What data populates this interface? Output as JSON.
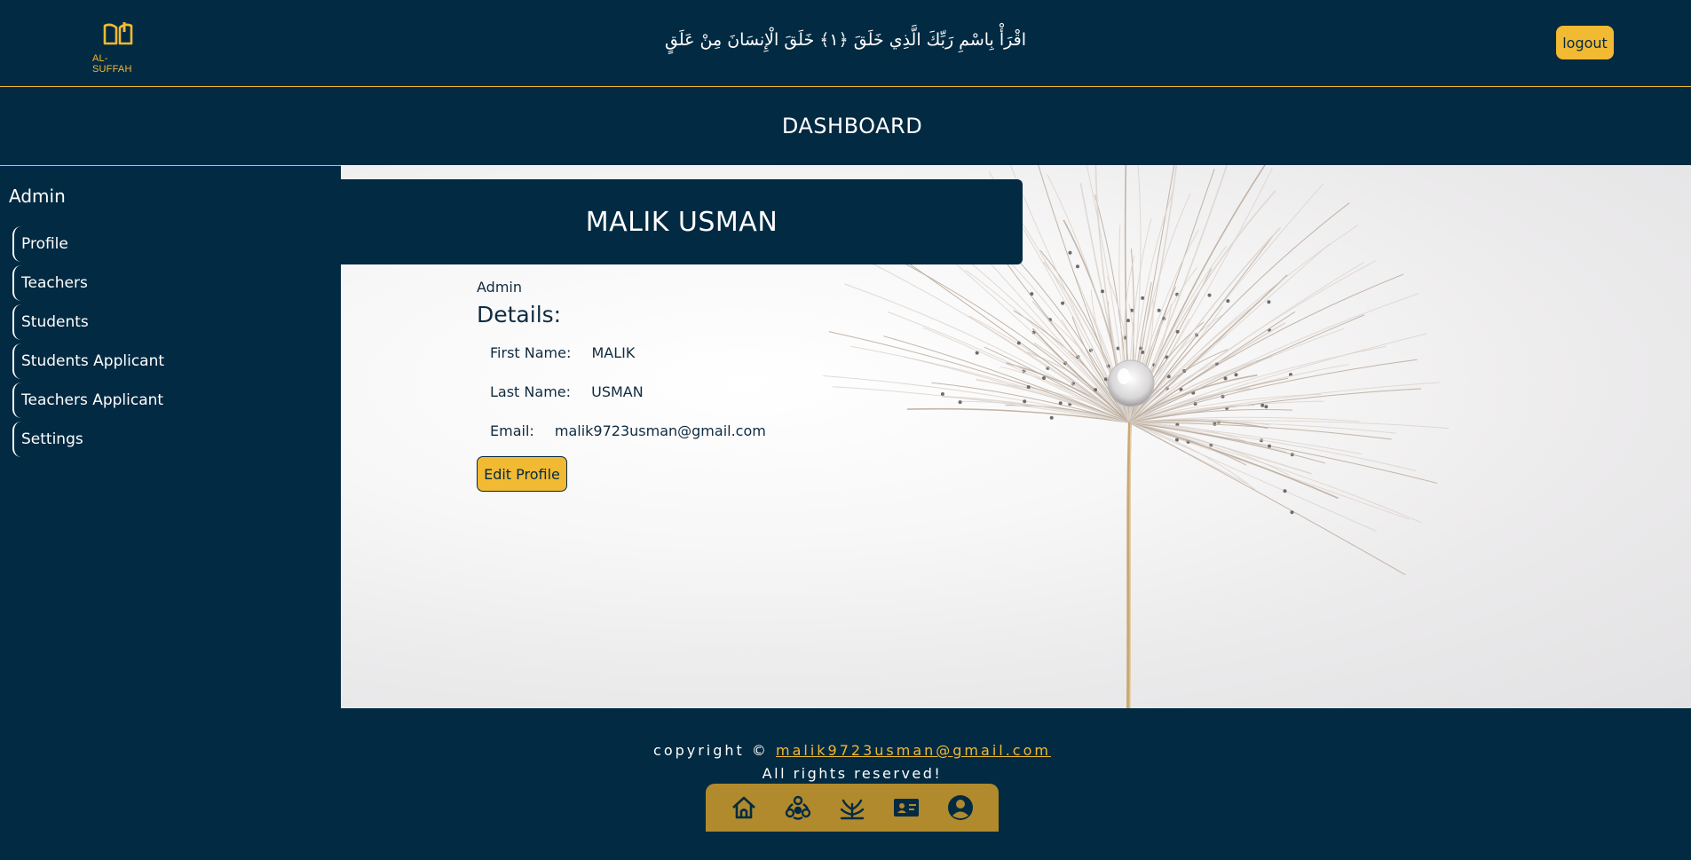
{
  "header": {
    "logo_text": "AL-SUFFAH",
    "verse": "اقْرَأْ بِاسْمِ رَبِّكَ الَّذِي خَلَقَ ﴿١﴾ خَلَقَ الْإِنسَانَ مِنْ عَلَقٍ",
    "logout_label": "logout"
  },
  "dashboard": {
    "title": "DASHBOARD"
  },
  "sidebar": {
    "title": "Admin",
    "items": [
      {
        "label": "Profile"
      },
      {
        "label": "Teachers"
      },
      {
        "label": "Students"
      },
      {
        "label": "Students Applicant"
      },
      {
        "label": "Teachers Applicant"
      },
      {
        "label": "Settings"
      }
    ]
  },
  "profile": {
    "name": "MALIK USMAN",
    "role": "Admin",
    "details_heading": "Details:",
    "first_name_label": "First Name:",
    "first_name": "MALIK",
    "last_name_label": "Last Name:",
    "last_name": "USMAN",
    "email_label": "Email:",
    "email": "malik9723usman@gmail.com",
    "edit_label": "Edit Profile"
  },
  "footer": {
    "copyright_prefix": "copyright © ",
    "copyright_email": "malik9723usman@gmail.com",
    "rights": "All rights reserved!",
    "nav_icons": [
      "home-icon",
      "community-icon",
      "growth-icon",
      "id-card-icon",
      "account-icon"
    ]
  },
  "colors": {
    "navy": "#022a42",
    "gold": "#f2b933",
    "footer_nav": "#b08a2c"
  }
}
